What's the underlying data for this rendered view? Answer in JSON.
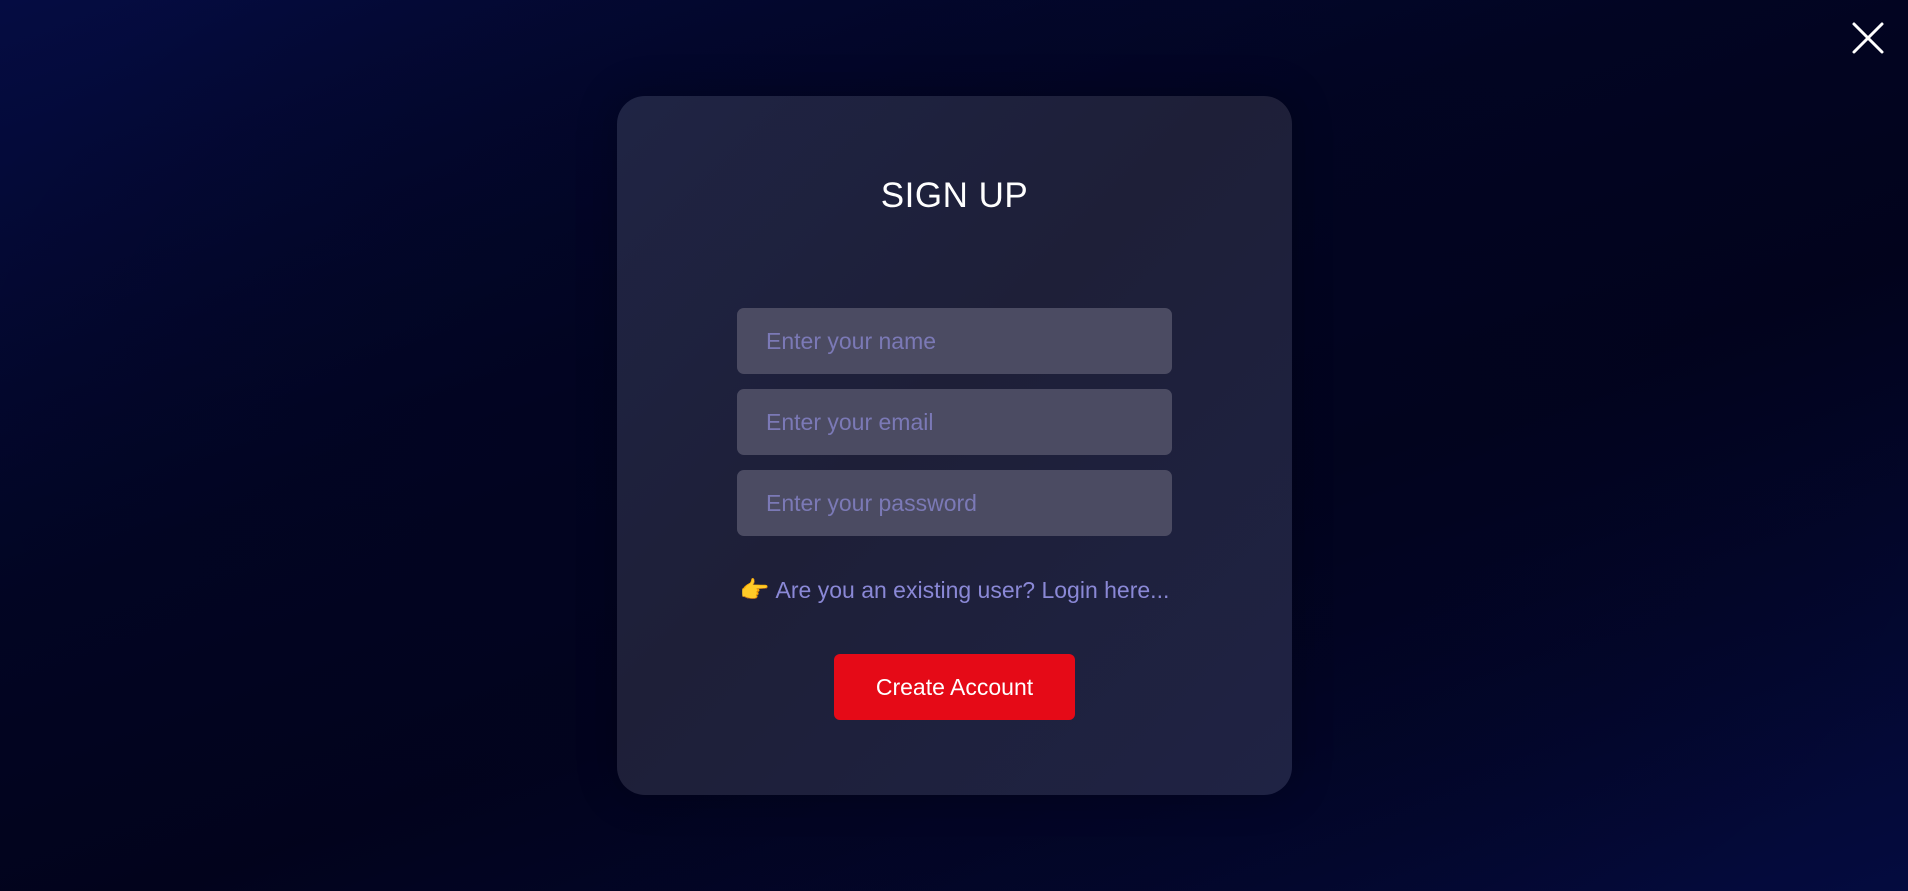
{
  "close": {
    "icon": "close-icon"
  },
  "signup": {
    "title": "SIGN UP",
    "fields": {
      "name": {
        "placeholder": "Enter your name",
        "value": ""
      },
      "email": {
        "placeholder": "Enter your email",
        "value": ""
      },
      "password": {
        "placeholder": "Enter your password",
        "value": ""
      }
    },
    "login_prompt": {
      "emoji": "👉",
      "text": "Are you an existing user? Login here..."
    },
    "submit_label": "Create Account"
  },
  "colors": {
    "accent": "#e50a17",
    "card": "#1f2343",
    "field": "#4b4b62",
    "link": "#8a88d6",
    "placeholder": "#7b79b6"
  }
}
